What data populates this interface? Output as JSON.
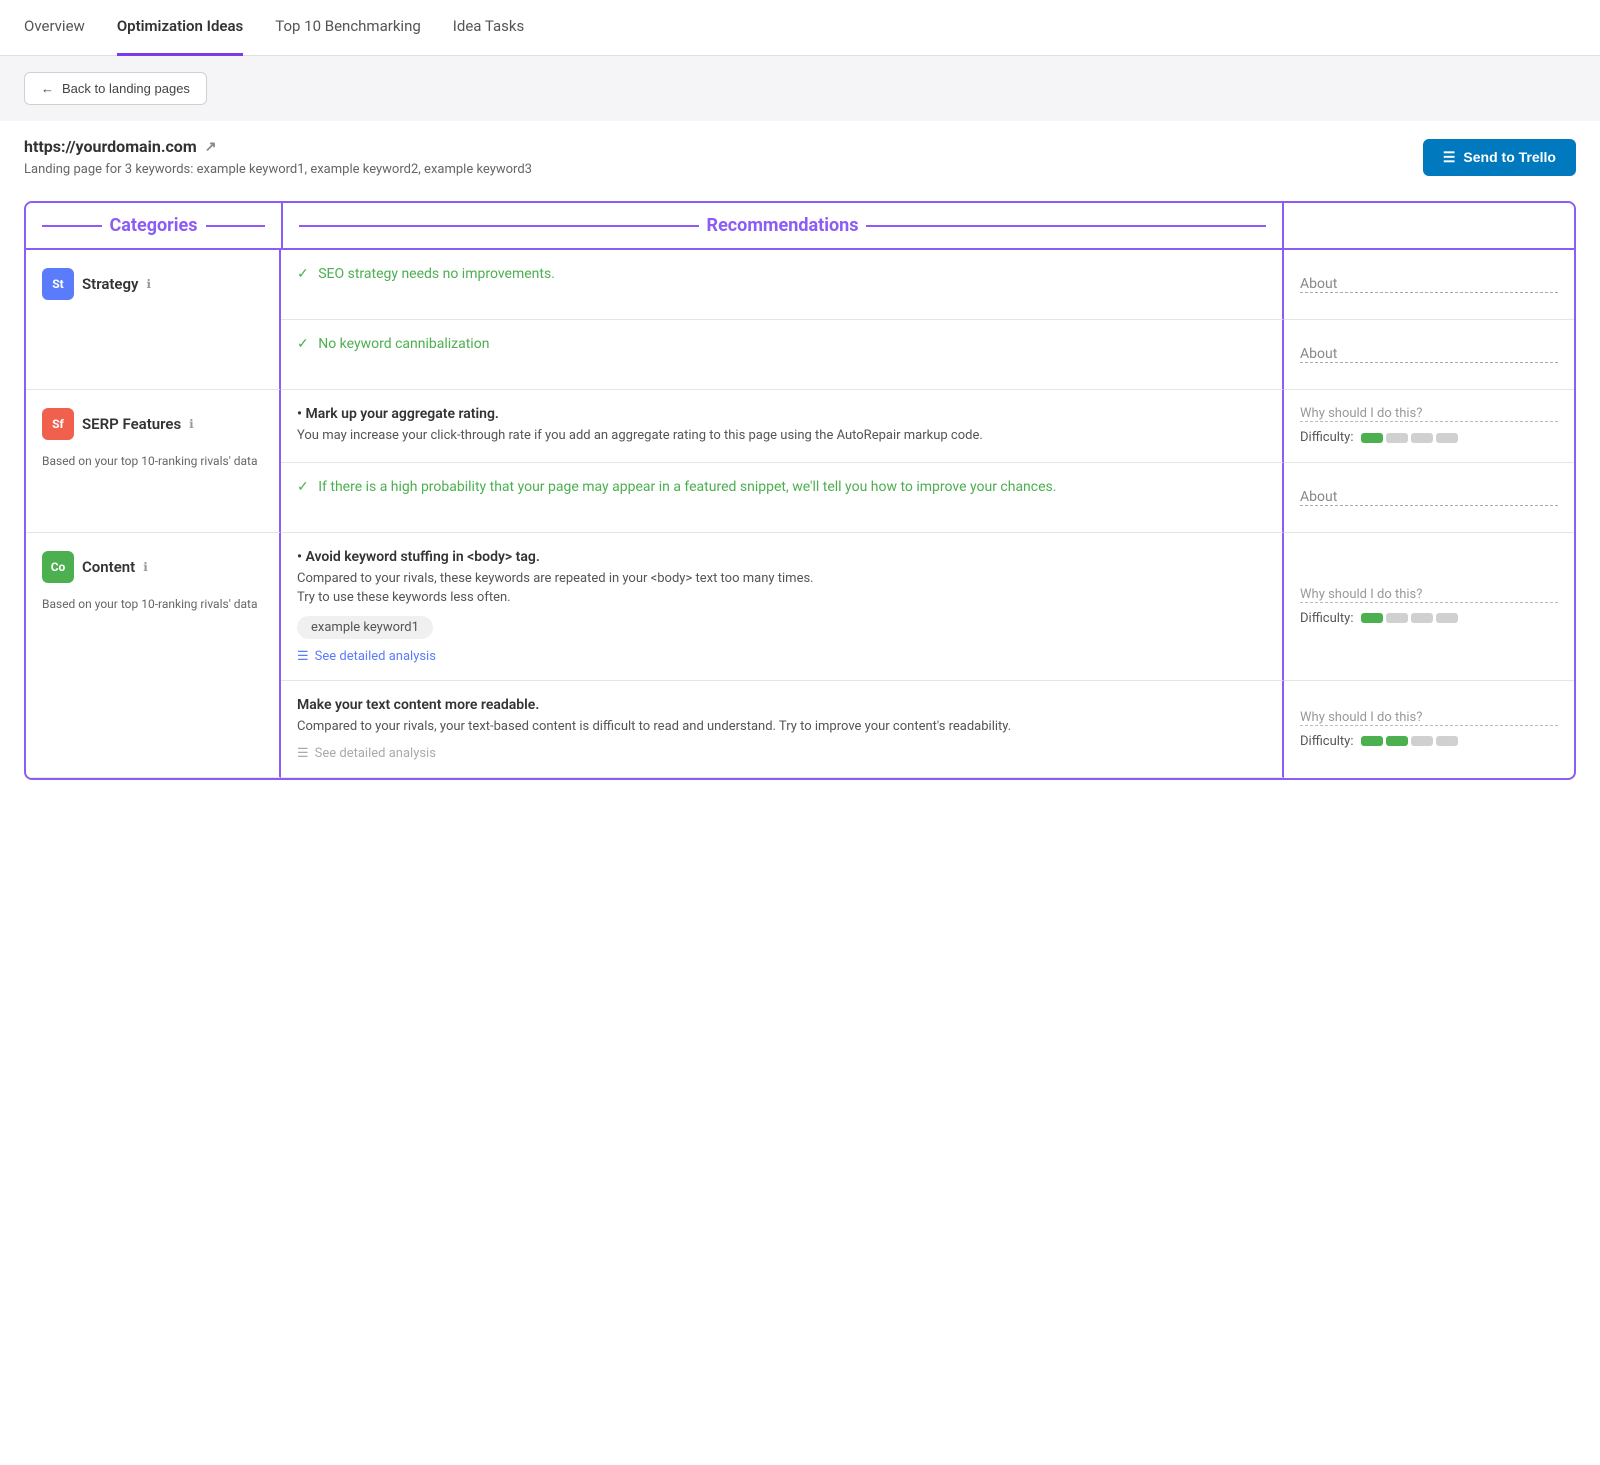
{
  "nav": {
    "items": [
      {
        "label": "Overview",
        "active": false
      },
      {
        "label": "Optimization Ideas",
        "active": true
      },
      {
        "label": "Top 10 Benchmarking",
        "active": false
      },
      {
        "label": "Idea Tasks",
        "active": false
      }
    ]
  },
  "back_button": "Back to landing pages",
  "domain": {
    "url": "https://yourdomain.com",
    "keywords_label": "Landing page for 3 keywords: example keyword1, example keyword2, example keyword3"
  },
  "trello_button": "Send to Trello",
  "table": {
    "col_categories": "Categories",
    "col_recommendations": "Recommendations",
    "categories": [
      {
        "badge": "St",
        "badge_class": "badge-strategy",
        "name": "Strategy",
        "sub": "",
        "recs": [
          {
            "type": "check",
            "text": "SEO strategy needs no improvements.",
            "desc": ""
          },
          {
            "type": "check",
            "text": "No keyword cannibalization",
            "desc": ""
          }
        ],
        "abouts": [
          {
            "type": "about",
            "text": "About"
          },
          {
            "type": "about",
            "text": "About"
          }
        ]
      },
      {
        "badge": "Sf",
        "badge_class": "badge-serp",
        "name": "SERP Features",
        "sub": "Based on your top 10-ranking rivals' data",
        "recs": [
          {
            "type": "bullet",
            "title": "Mark up your aggregate rating.",
            "desc": "You may increase your click-through rate if you add an aggregate rating to this page using the AutoRepair markup code.",
            "why": true,
            "difficulty": [
              1,
              0,
              0,
              0
            ]
          },
          {
            "type": "check",
            "text": "If there is a high probability that your page may appear in a featured snippet, we'll tell you how to improve your chances.",
            "desc": "",
            "why": false
          }
        ],
        "abouts": [
          {
            "type": "why",
            "difficulty": [
              1,
              0,
              0,
              0
            ]
          },
          {
            "type": "about",
            "text": "About"
          }
        ]
      },
      {
        "badge": "Co",
        "badge_class": "badge-content",
        "name": "Content",
        "sub": "Based on your top 10-ranking rivals' data",
        "recs": [
          {
            "type": "bullet",
            "title": "Avoid keyword stuffing in <body> tag.",
            "desc": "Compared to your rivals, these keywords are repeated in your <body> text too many times.\nTry to use these keywords less often.",
            "tag": "example keyword1",
            "link": "See detailed analysis",
            "why": true,
            "difficulty": [
              1,
              0,
              0,
              0
            ]
          },
          {
            "type": "bullet",
            "title": "Make your text content more readable.",
            "desc": "Compared to your rivals, your text-based content is difficult to read and understand. Try to improve your content's readability.",
            "link": "See detailed analysis",
            "why": true,
            "difficulty": [
              1,
              1,
              0,
              0
            ]
          }
        ],
        "abouts": [
          {
            "type": "why",
            "difficulty": [
              1,
              0,
              0,
              0
            ]
          },
          {
            "type": "why",
            "difficulty": [
              1,
              1,
              0,
              0
            ]
          }
        ]
      }
    ]
  },
  "labels": {
    "why": "Why should I do this?",
    "difficulty": "Difficulty:",
    "about": "About"
  }
}
